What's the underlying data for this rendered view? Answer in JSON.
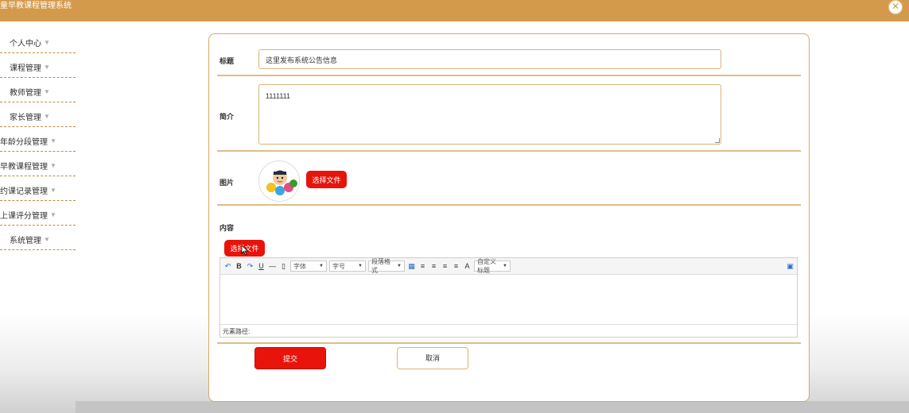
{
  "app": {
    "title": "童早教课程管理系统"
  },
  "sidebar": {
    "items": [
      {
        "label": "个人中心"
      },
      {
        "label": "课程管理"
      },
      {
        "label": "教师管理"
      },
      {
        "label": "家长管理"
      },
      {
        "label": "年龄分段管理"
      },
      {
        "label": "早教课程管理"
      },
      {
        "label": "约课记录管理"
      },
      {
        "label": "上课评分管理"
      },
      {
        "label": "系统管理"
      }
    ]
  },
  "form": {
    "title_label": "标题",
    "title_value": "这里发布系统公告信息",
    "intro_label": "简介",
    "intro_value": "1111111",
    "image_label": "图片",
    "choose_file_label": "选择文件",
    "content_label": "内容",
    "content_choose_file_label": "选择文件",
    "submit_label": "提交",
    "cancel_label": "取消"
  },
  "editor": {
    "font_family_label": "字体",
    "font_size_label": "字号",
    "paragraph_label": "段落格式",
    "custom_title_label": "自定义标题",
    "path_label": "元素路径:"
  },
  "icons": {
    "close": "close-icon",
    "caret": "caret-down-icon"
  },
  "colors": {
    "topbar": "#d39a4b",
    "accent_red": "#e8140b",
    "border_gold": "#d4a868"
  }
}
